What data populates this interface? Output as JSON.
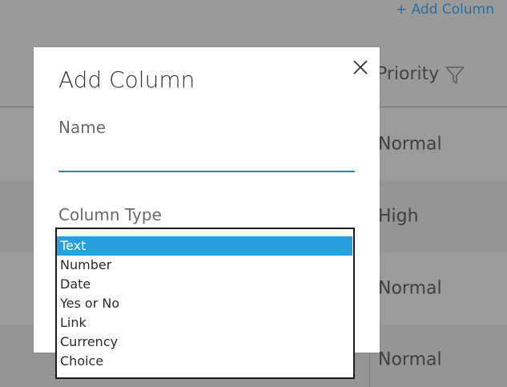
{
  "toolbar": {
    "add_column_label": "+ Add Column"
  },
  "table": {
    "priority_header": "Priority",
    "rows": [
      {
        "priority": "Normal"
      },
      {
        "priority": "High"
      },
      {
        "priority": "Normal"
      },
      {
        "priority": "Normal"
      }
    ]
  },
  "dialog": {
    "title": "Add Column",
    "name_label": "Name",
    "name_value": "",
    "column_type_label": "Column Type",
    "column_type_options": [
      "Text",
      "Number",
      "Date",
      "Yes or No",
      "Link",
      "Currency",
      "Choice"
    ],
    "selected_option": "Text"
  },
  "colors": {
    "overlay_background": "#9a9a9a",
    "accent_blue": "#2c83c5",
    "selection_blue": "#28a0e0",
    "link_blue": "#2a6fa0"
  },
  "icons": {
    "filter": "filter-icon",
    "close": "close-icon"
  }
}
